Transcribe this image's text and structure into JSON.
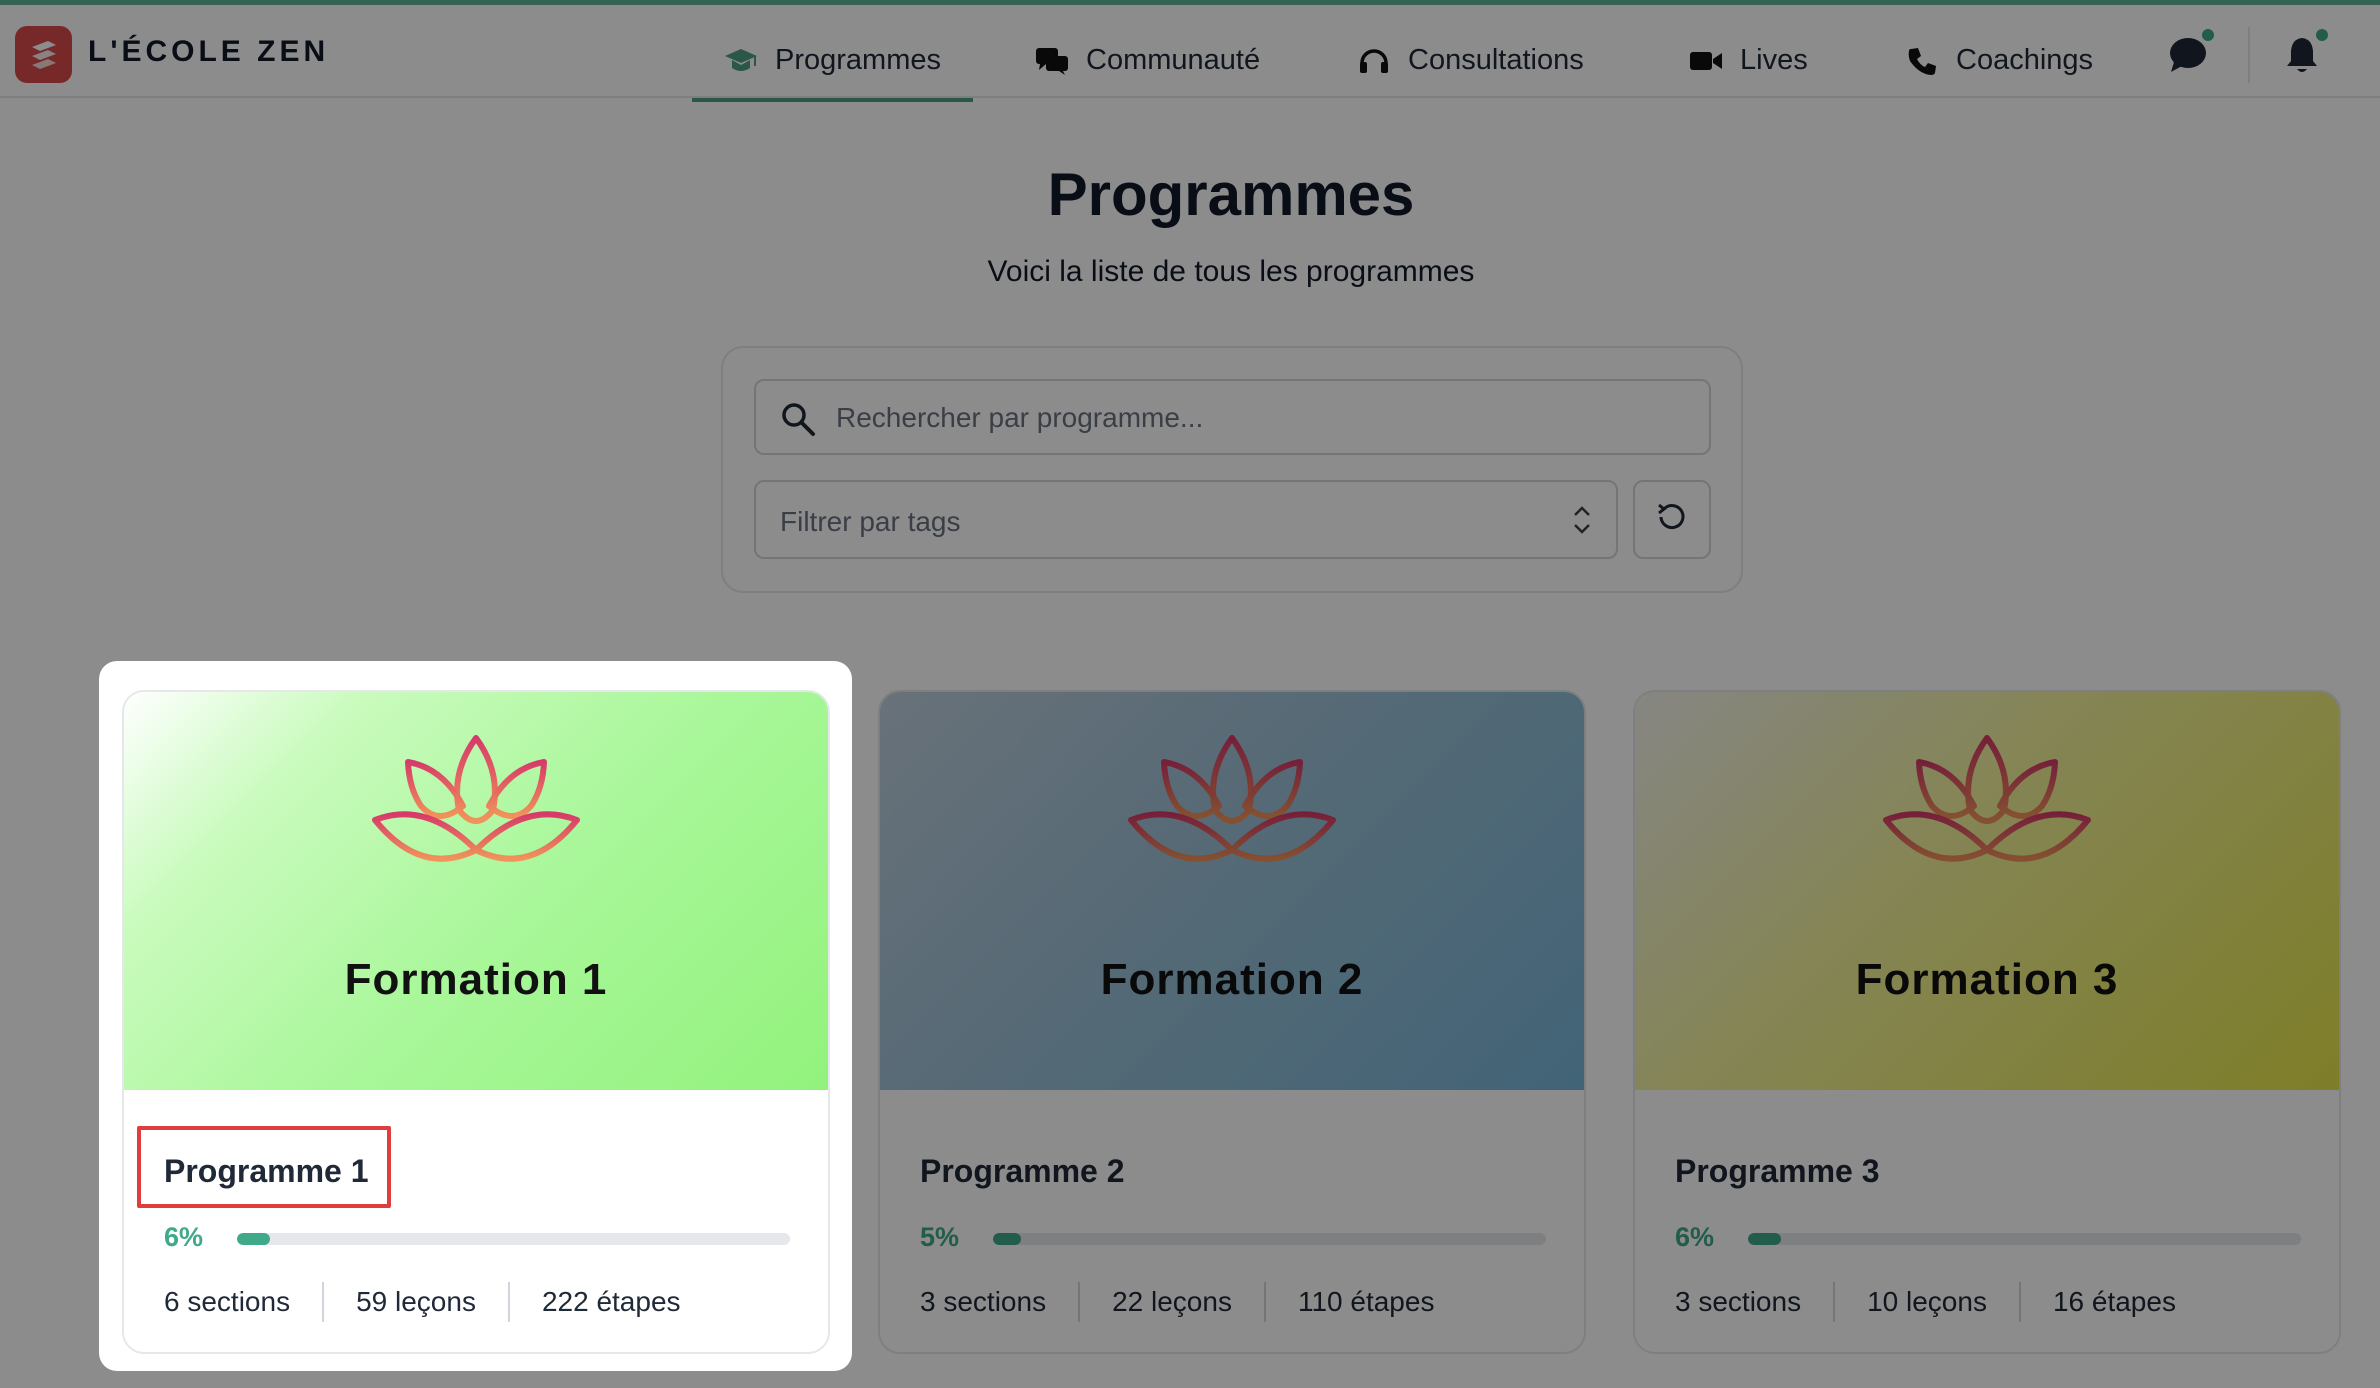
{
  "brand": {
    "name": "L'ÉCOLE ZEN"
  },
  "nav": {
    "items": [
      {
        "label": "Programmes",
        "icon": "graduation-cap-icon",
        "active": true
      },
      {
        "label": "Communauté",
        "icon": "comments-icon",
        "active": false
      },
      {
        "label": "Consultations",
        "icon": "headset-icon",
        "active": false
      },
      {
        "label": "Lives",
        "icon": "video-camera-icon",
        "active": false
      },
      {
        "label": "Coachings",
        "icon": "phone-icon",
        "active": false
      }
    ],
    "chat_icon": "chat-bubble-icon",
    "bell_icon": "bell-icon"
  },
  "header": {
    "title": "Programmes",
    "subtitle": "Voici la liste de tous les programmes"
  },
  "filters": {
    "search_placeholder": "Rechercher par programme...",
    "tags_placeholder": "Filtrer par tags",
    "reset_icon": "reset-icon"
  },
  "programs": [
    {
      "hero_title": "Formation 1",
      "name": "Programme 1",
      "progress_label": "6%",
      "progress": 0.06,
      "sections": "6 sections",
      "lessons": "59 leçons",
      "steps": "222 étapes"
    },
    {
      "hero_title": "Formation 2",
      "name": "Programme 2",
      "progress_label": "5%",
      "progress": 0.05,
      "sections": "3 sections",
      "lessons": "22 leçons",
      "steps": "110 étapes"
    },
    {
      "hero_title": "Formation 3",
      "name": "Programme 3",
      "progress_label": "6%",
      "progress": 0.06,
      "sections": "3 sections",
      "lessons": "10 leçons",
      "steps": "16 étapes"
    }
  ],
  "colors": {
    "accent": "#3fa98a",
    "logo": "#d94b4b",
    "highlight": "#e03e3e"
  }
}
